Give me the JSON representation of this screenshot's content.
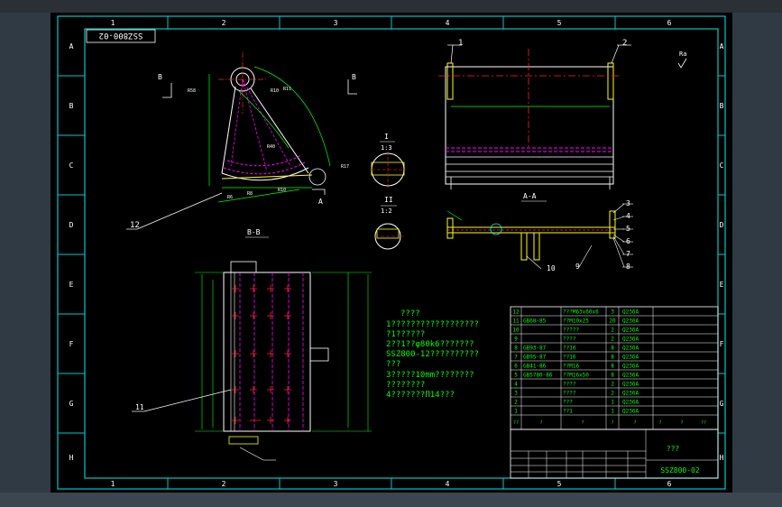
{
  "frame": {
    "col_numbers": [
      "1",
      "2",
      "3",
      "4",
      "5",
      "6"
    ],
    "row_letters": [
      "A",
      "B",
      "C",
      "D",
      "E",
      "F",
      "G",
      "H"
    ]
  },
  "titleblock": {
    "drawing_no_rotated": "SSZ800-02",
    "drawing_no": "SSZ800-02",
    "name": "???"
  },
  "views": {
    "section_bb": "B-B",
    "section_aa": "A-A",
    "detail_I": "I",
    "detail_I_scale": "1:3",
    "detail_II": "II",
    "detail_II_scale": "1:2",
    "cut_B_left": "B",
    "cut_B_right": "B",
    "cut_A": "A",
    "roughness": "Ra"
  },
  "balloons": [
    "1",
    "2",
    "3",
    "4",
    "5",
    "6",
    "7",
    "8",
    "9",
    "10",
    "11",
    "12"
  ],
  "notes": [
    "????",
    "1??????????????????",
    "  ?1??????",
    "2??1??φ80k6???????",
    "  SSZ800-12??????????",
    "  ???",
    "3?????10mm????????",
    "  ????????",
    "4???????П14???"
  ],
  "bom": [
    {
      "no": "12",
      "code": "",
      "name": "???M63x60x6",
      "qty": "3",
      "mat": "Q236A"
    },
    {
      "no": "11",
      "code": "GB68-85",
      "name": "??M10x25",
      "qty": "20",
      "mat": "Q236A"
    },
    {
      "no": "10",
      "code": "",
      "name": "?????",
      "qty": "2",
      "mat": "Q236A"
    },
    {
      "no": "9",
      "code": "",
      "name": "????",
      "qty": "2",
      "mat": "Q236A"
    },
    {
      "no": "8",
      "code": "GB93-87",
      "name": "??16",
      "qty": "8",
      "mat": "Q236A"
    },
    {
      "no": "7",
      "code": "GB95-87",
      "name": "??16",
      "qty": "8",
      "mat": "Q236A"
    },
    {
      "no": "6",
      "code": "GB41-86",
      "name": "??M16",
      "qty": "8",
      "mat": "Q236A"
    },
    {
      "no": "5",
      "code": "GB5780-86",
      "name": "??M16x50",
      "qty": "8",
      "mat": "Q236A"
    },
    {
      "no": "4",
      "code": "",
      "name": "????",
      "qty": "2",
      "mat": "Q236A"
    },
    {
      "no": "3",
      "code": "",
      "name": "????",
      "qty": "2",
      "mat": "Q236A"
    },
    {
      "no": "2",
      "code": "",
      "name": "???",
      "qty": "1",
      "mat": "Q236A"
    },
    {
      "no": "1",
      "code": "",
      "name": "??1",
      "qty": "1",
      "mat": "Q236A"
    }
  ],
  "bom_header": [
    "??",
    "?",
    "?",
    "?",
    "?",
    "?",
    "?",
    "??"
  ],
  "colors": {
    "frame": "#9ea8b6",
    "border_cyan": "#00c8c8",
    "geometry": "#ffffff",
    "hidden": "#ff00ff",
    "center": "#ff2020",
    "dimension": "#00ff00",
    "flange": "#ffff00",
    "leader": "#00ffff"
  }
}
